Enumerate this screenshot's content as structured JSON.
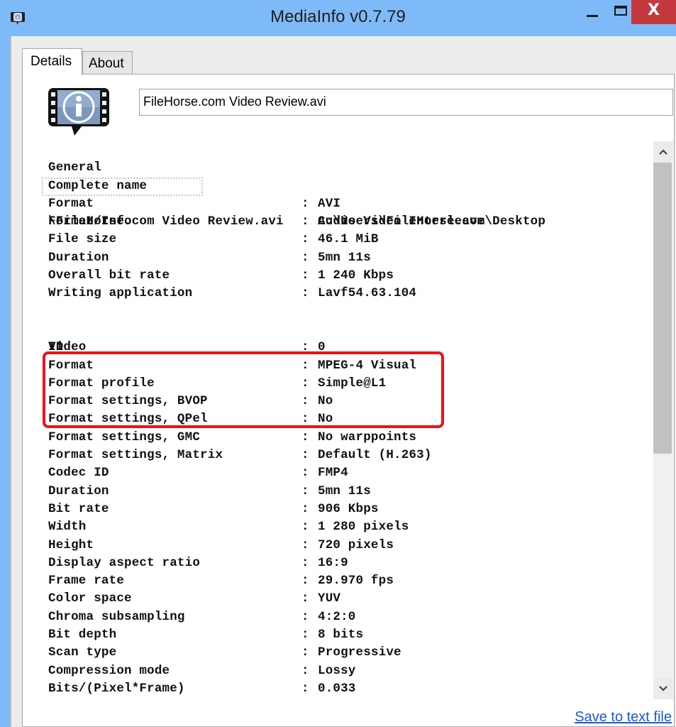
{
  "window": {
    "title": "MediaInfo v0.7.79",
    "icon": "mediainfo-app-icon",
    "controls": {
      "minimize": "minimize",
      "maximize": "maximize",
      "close": "X"
    },
    "colors": {
      "titlebar": "#7fbaf8",
      "close_button": "#c4393d",
      "highlight_border": "#e8131b",
      "link": "#1c5ad6"
    }
  },
  "tabs": [
    {
      "label": "Details",
      "active": true
    },
    {
      "label": "About",
      "active": false
    }
  ],
  "file": {
    "name": "FileHorse.com Video Review.avi"
  },
  "sections": {
    "general": {
      "title": "General",
      "complete_name_label": "Complete name",
      "complete_name_value": "C:\\Users\\FileHorse.com\\Desktop",
      "complete_name_wrap": "\\FileHorse.com Video Review.avi",
      "rows": [
        {
          "key": "Format",
          "value": "AVI"
        },
        {
          "key": "Format/Info",
          "value": "Audio Video Interleave"
        },
        {
          "key": "File size",
          "value": "46.1 MiB"
        },
        {
          "key": "Duration",
          "value": "5mn 11s"
        },
        {
          "key": "Overall bit rate",
          "value": "1 240 Kbps"
        },
        {
          "key": "Writing application",
          "value": "Lavf54.63.104"
        }
      ]
    },
    "video": {
      "title": "Video",
      "rows": [
        {
          "key": "ID",
          "value": "0"
        },
        {
          "key": "Format",
          "value": "MPEG-4 Visual"
        },
        {
          "key": "Format profile",
          "value": "Simple@L1"
        },
        {
          "key": "Format settings, BVOP",
          "value": "No"
        },
        {
          "key": "Format settings, QPel",
          "value": "No"
        },
        {
          "key": "Format settings, GMC",
          "value": "No warppoints"
        },
        {
          "key": "Format settings, Matrix",
          "value": "Default (H.263)"
        },
        {
          "key": "Codec ID",
          "value": "FMP4"
        },
        {
          "key": "Duration",
          "value": "5mn 11s"
        },
        {
          "key": "Bit rate",
          "value": "906 Kbps"
        },
        {
          "key": "Width",
          "value": "1 280 pixels"
        },
        {
          "key": "Height",
          "value": "720 pixels"
        },
        {
          "key": "Display aspect ratio",
          "value": "16:9"
        },
        {
          "key": "Frame rate",
          "value": "29.970 fps"
        },
        {
          "key": "Color space",
          "value": "YUV"
        },
        {
          "key": "Chroma subsampling",
          "value": "4:2:0"
        },
        {
          "key": "Bit depth",
          "value": "8 bits"
        },
        {
          "key": "Scan type",
          "value": "Progressive"
        },
        {
          "key": "Compression mode",
          "value": "Lossy"
        },
        {
          "key": "Bits/(Pixel*Frame)",
          "value": "0.033"
        }
      ]
    }
  },
  "separator": ":",
  "scrollbar": {
    "up_icon": "^",
    "down_icon": "v"
  },
  "actions": {
    "save_link": "Save to text file"
  }
}
